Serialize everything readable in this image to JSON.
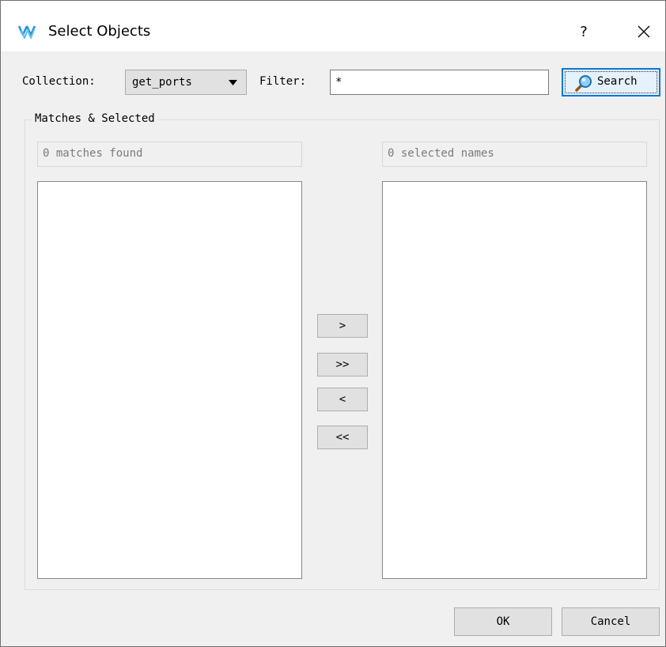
{
  "window": {
    "title": "Select Objects",
    "help_label": "?",
    "close_icon": "close-icon",
    "app_icon": "gowin-logo-icon"
  },
  "toolbar": {
    "collection_label": "Collection:",
    "collection_value": "get_ports",
    "filter_label": "Filter:",
    "filter_value": "*",
    "search_label": "Search",
    "search_icon": "magnifier-icon"
  },
  "group": {
    "title": "Matches & Selected",
    "matches_status": "0 matches found",
    "selected_status": "0 selected names",
    "matches_items": [],
    "selected_items": []
  },
  "move_buttons": {
    "add": ">",
    "add_all": ">>",
    "remove": "<",
    "remove_all": "<<"
  },
  "footer": {
    "ok_label": "OK",
    "cancel_label": "Cancel"
  },
  "colors": {
    "accent": "#0078d7",
    "dialog_bg": "#f0f0f0",
    "button_bg": "#e1e1e1"
  }
}
